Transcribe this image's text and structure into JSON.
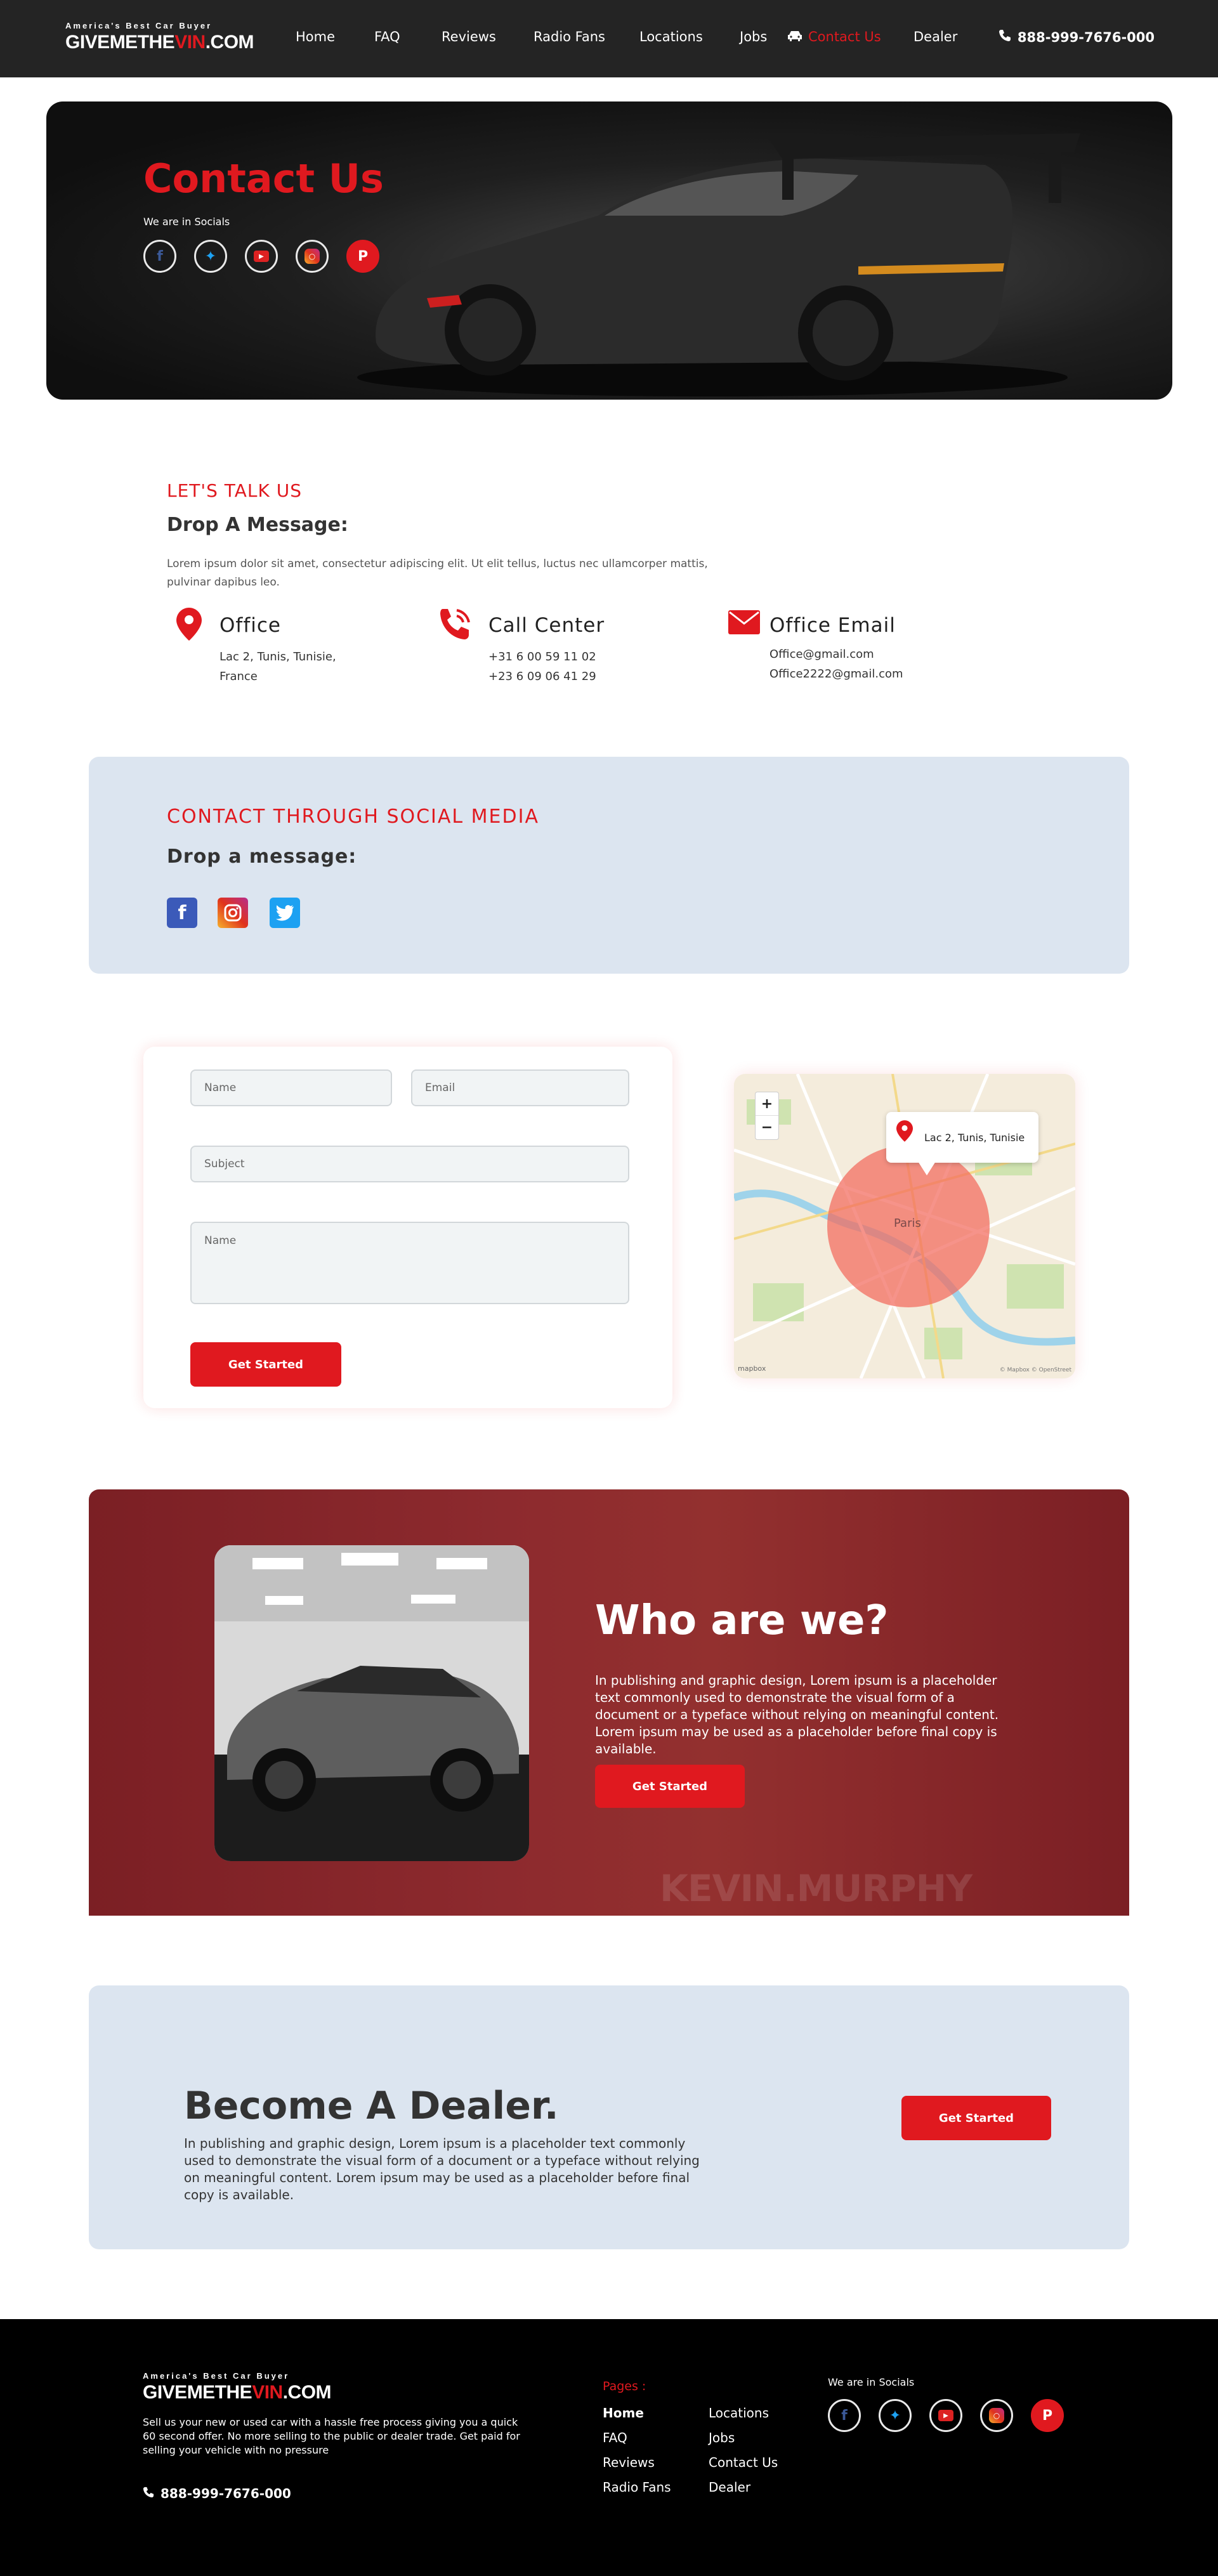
{
  "header": {
    "logo_tagline": "America's Best Car Buyer",
    "logo_part1": "GIVEMETHE",
    "logo_part2": "VIN",
    "logo_part3": ".COM",
    "nav": [
      "Home",
      "FAQ",
      "Reviews",
      "Radio Fans",
      "Locations",
      "Jobs",
      "Contact Us",
      "Dealer"
    ],
    "active_nav": "Contact Us",
    "phone": "888-999-7676-000"
  },
  "hero": {
    "title": "Contact Us",
    "socials_label": "We are in Socials",
    "socials": [
      "facebook-icon",
      "twitter-icon",
      "youtube-icon",
      "instagram-icon",
      "pinterest-icon"
    ]
  },
  "talk": {
    "eyebrow": "LET'S TALK US",
    "heading": "Drop A Message:",
    "body": "Lorem ipsum dolor sit amet, consectetur adipiscing elit. Ut elit tellus, luctus nec ullamcorper mattis, pulvinar dapibus leo.",
    "office": {
      "title": "Office",
      "line1": "Lac 2, Tunis, Tunisie,",
      "line2": "France"
    },
    "call": {
      "title": "Call Center",
      "line1": "+31 6 00 59 11 02",
      "line2": "+23 6 09 06 41 29"
    },
    "email": {
      "title": "Office Email",
      "line1": "Office@gmail.com",
      "line2": "Office2222@gmail.com"
    }
  },
  "social_panel": {
    "eyebrow": "CONTACT THROUGH SOCIAL MEDIA",
    "heading": "Drop a message:",
    "icons": [
      "facebook-icon",
      "instagram-icon",
      "twitter-icon"
    ]
  },
  "form": {
    "name_placeholder": "Name",
    "email_placeholder": "Email",
    "subject_placeholder": "Subject",
    "message_placeholder": "Name",
    "submit_label": "Get Started"
  },
  "map": {
    "zoom_in": "+",
    "zoom_out": "−",
    "pin_label": "Lac 2, Tunis, Tunisie",
    "city_label": "Paris",
    "attribution": "© Mapbox © OpenStreet",
    "mapbox_label": "mapbox"
  },
  "who": {
    "title": "Who are we?",
    "text": "In publishing and graphic design, Lorem ipsum is a placeholder text commonly used to demonstrate the visual form of a document or a typeface without relying on meaningful content. Lorem ipsum may be used as a placeholder before final copy is available.",
    "button": "Get Started",
    "bg_sign": "KEVIN.MURPHY"
  },
  "dealer": {
    "title": "Become A Dealer.",
    "text": "In publishing and graphic design, Lorem ipsum is a placeholder text commonly used to demonstrate the visual form of a document or a typeface without relying on meaningful content. Lorem ipsum may be used as a placeholder before final copy is available.",
    "button": "Get Started"
  },
  "footer": {
    "logo_tagline": "America's Best Car Buyer",
    "description": "Sell us your new or used car with a hassle free process giving you a quick 60 second offer. No more selling to the public or dealer trade. Get paid for selling your vehicle with no pressure",
    "phone": "888-999-7676-000",
    "pages_label": "Pages :",
    "col1": [
      "Home",
      "FAQ",
      "Reviews",
      "Radio Fans"
    ],
    "col2": [
      "Locations",
      "Jobs",
      "Contact Us",
      "Dealer"
    ],
    "socials_label": "We are in Socials"
  },
  "colors": {
    "accent": "#e0191f",
    "panel": "#dce5f0",
    "dark": "#242424"
  }
}
